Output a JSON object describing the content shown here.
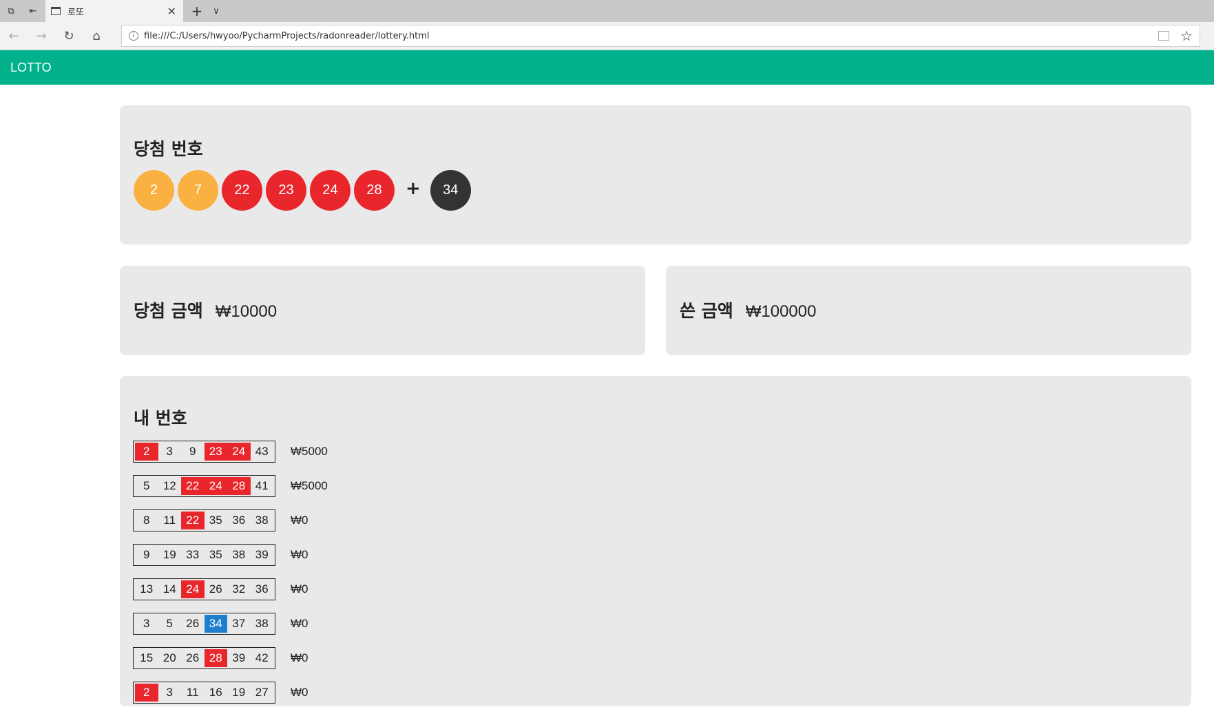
{
  "browser": {
    "tab_title": "로또",
    "url": "file:///C:/Users/hwyoo/PycharmProjects/radonreader/lottery.html"
  },
  "app": {
    "title": "LOTTO"
  },
  "winning": {
    "heading": "당첨 번호",
    "numbers": [
      {
        "value": "2",
        "color": "#fbb042"
      },
      {
        "value": "7",
        "color": "#fbb042"
      },
      {
        "value": "22",
        "color": "#e8262c"
      },
      {
        "value": "23",
        "color": "#e8262c"
      },
      {
        "value": "24",
        "color": "#e8262c"
      },
      {
        "value": "28",
        "color": "#e8262c"
      }
    ],
    "plus": "+",
    "bonus": {
      "value": "34",
      "color": "#333333"
    }
  },
  "prize": {
    "label": "당첨 금액",
    "value": "₩10000"
  },
  "spent": {
    "label": "쓴 금액",
    "value": "₩100000"
  },
  "mine": {
    "heading": "내 번호",
    "tickets": [
      {
        "numbers": [
          "2",
          "3",
          "9",
          "23",
          "24",
          "43"
        ],
        "status": [
          "hit",
          "",
          "",
          "hit",
          "hit",
          ""
        ],
        "prize": "₩5000"
      },
      {
        "numbers": [
          "5",
          "12",
          "22",
          "24",
          "28",
          "41"
        ],
        "status": [
          "",
          "",
          "hit",
          "hit",
          "hit",
          ""
        ],
        "prize": "₩5000"
      },
      {
        "numbers": [
          "8",
          "11",
          "22",
          "35",
          "36",
          "38"
        ],
        "status": [
          "",
          "",
          "hit",
          "",
          "",
          ""
        ],
        "prize": "₩0"
      },
      {
        "numbers": [
          "9",
          "19",
          "33",
          "35",
          "38",
          "39"
        ],
        "status": [
          "",
          "",
          "",
          "",
          "",
          ""
        ],
        "prize": "₩0"
      },
      {
        "numbers": [
          "13",
          "14",
          "24",
          "26",
          "32",
          "36"
        ],
        "status": [
          "",
          "",
          "hit",
          "",
          "",
          ""
        ],
        "prize": "₩0"
      },
      {
        "numbers": [
          "3",
          "5",
          "26",
          "34",
          "37",
          "38"
        ],
        "status": [
          "",
          "",
          "",
          "bonus",
          "",
          ""
        ],
        "prize": "₩0"
      },
      {
        "numbers": [
          "15",
          "20",
          "26",
          "28",
          "39",
          "42"
        ],
        "status": [
          "",
          "",
          "",
          "hit",
          "",
          ""
        ],
        "prize": "₩0"
      },
      {
        "numbers": [
          "2",
          "3",
          "11",
          "16",
          "19",
          "27"
        ],
        "status": [
          "hit",
          "",
          "",
          "",
          "",
          ""
        ],
        "prize": "₩0"
      }
    ]
  },
  "colors": {
    "header": "#00b18b",
    "hit": "#e8262c",
    "bonus_hit": "#1f7fcf",
    "card": "#e9e9e9"
  }
}
